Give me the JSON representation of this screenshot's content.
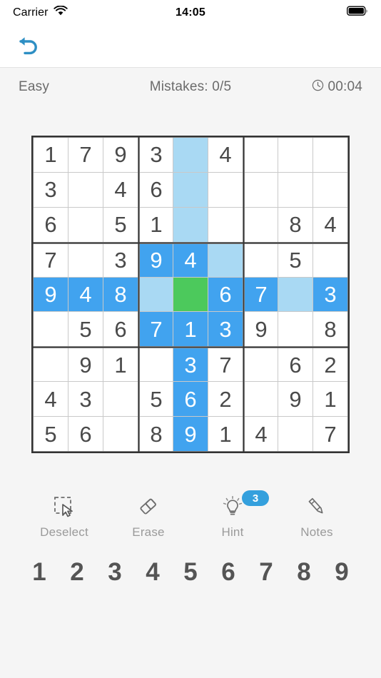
{
  "status_bar": {
    "carrier": "Carrier",
    "wifi_icon": "wifi-icon",
    "time": "14:05",
    "battery_icon": "battery-full-icon"
  },
  "nav": {
    "undo_icon": "undo-arrow-icon",
    "undo_color": "#2e8fc4"
  },
  "info": {
    "difficulty": "Easy",
    "mistakes": "Mistakes: 0/5",
    "timer_icon": "clock-icon",
    "timer": "00:04"
  },
  "board": {
    "colors": {
      "grid_line_thick": "#333333",
      "grid_line_thin": "#c9c9c9",
      "cell_bg": "#ffffff",
      "highlight_peer": "#41a3ef",
      "highlight_soft": "#a9d9f3",
      "highlight_selected": "#4cc95c",
      "digit": "#4a4a4a",
      "digit_on_highlight": "#ffffff"
    },
    "selected_cell": {
      "row": 5,
      "col": 5
    },
    "rows": [
      [
        {
          "v": "1",
          "s": "normal"
        },
        {
          "v": "7",
          "s": "normal"
        },
        {
          "v": "9",
          "s": "normal"
        },
        {
          "v": "3",
          "s": "normal"
        },
        {
          "v": "",
          "s": "soft"
        },
        {
          "v": "4",
          "s": "normal"
        },
        {
          "v": "",
          "s": "normal"
        },
        {
          "v": "",
          "s": "normal"
        },
        {
          "v": "",
          "s": "normal"
        }
      ],
      [
        {
          "v": "3",
          "s": "normal"
        },
        {
          "v": "",
          "s": "normal"
        },
        {
          "v": "4",
          "s": "normal"
        },
        {
          "v": "6",
          "s": "normal"
        },
        {
          "v": "",
          "s": "soft"
        },
        {
          "v": "",
          "s": "normal"
        },
        {
          "v": "",
          "s": "normal"
        },
        {
          "v": "",
          "s": "normal"
        },
        {
          "v": "",
          "s": "normal"
        }
      ],
      [
        {
          "v": "6",
          "s": "normal"
        },
        {
          "v": "",
          "s": "normal"
        },
        {
          "v": "5",
          "s": "normal"
        },
        {
          "v": "1",
          "s": "normal"
        },
        {
          "v": "",
          "s": "soft"
        },
        {
          "v": "",
          "s": "normal"
        },
        {
          "v": "",
          "s": "normal"
        },
        {
          "v": "8",
          "s": "normal"
        },
        {
          "v": "4",
          "s": "normal"
        }
      ],
      [
        {
          "v": "7",
          "s": "normal"
        },
        {
          "v": "",
          "s": "normal"
        },
        {
          "v": "3",
          "s": "normal"
        },
        {
          "v": "9",
          "s": "peer"
        },
        {
          "v": "4",
          "s": "peer"
        },
        {
          "v": "",
          "s": "soft"
        },
        {
          "v": "",
          "s": "normal"
        },
        {
          "v": "5",
          "s": "normal"
        },
        {
          "v": "",
          "s": "normal"
        }
      ],
      [
        {
          "v": "9",
          "s": "peer"
        },
        {
          "v": "4",
          "s": "peer"
        },
        {
          "v": "8",
          "s": "peer"
        },
        {
          "v": "",
          "s": "soft"
        },
        {
          "v": "",
          "s": "selected"
        },
        {
          "v": "6",
          "s": "peer"
        },
        {
          "v": "7",
          "s": "peer"
        },
        {
          "v": "",
          "s": "soft"
        },
        {
          "v": "3",
          "s": "peer"
        }
      ],
      [
        {
          "v": "",
          "s": "normal"
        },
        {
          "v": "5",
          "s": "normal"
        },
        {
          "v": "6",
          "s": "normal"
        },
        {
          "v": "7",
          "s": "peer"
        },
        {
          "v": "1",
          "s": "peer"
        },
        {
          "v": "3",
          "s": "peer"
        },
        {
          "v": "9",
          "s": "normal"
        },
        {
          "v": "",
          "s": "normal"
        },
        {
          "v": "8",
          "s": "normal"
        }
      ],
      [
        {
          "v": "",
          "s": "normal"
        },
        {
          "v": "9",
          "s": "normal"
        },
        {
          "v": "1",
          "s": "normal"
        },
        {
          "v": "",
          "s": "normal"
        },
        {
          "v": "3",
          "s": "peer"
        },
        {
          "v": "7",
          "s": "normal"
        },
        {
          "v": "",
          "s": "normal"
        },
        {
          "v": "6",
          "s": "normal"
        },
        {
          "v": "2",
          "s": "normal"
        }
      ],
      [
        {
          "v": "4",
          "s": "normal"
        },
        {
          "v": "3",
          "s": "normal"
        },
        {
          "v": "",
          "s": "normal"
        },
        {
          "v": "5",
          "s": "normal"
        },
        {
          "v": "6",
          "s": "peer"
        },
        {
          "v": "2",
          "s": "normal"
        },
        {
          "v": "",
          "s": "normal"
        },
        {
          "v": "9",
          "s": "normal"
        },
        {
          "v": "1",
          "s": "normal"
        }
      ],
      [
        {
          "v": "5",
          "s": "normal"
        },
        {
          "v": "6",
          "s": "normal"
        },
        {
          "v": "",
          "s": "normal"
        },
        {
          "v": "8",
          "s": "normal"
        },
        {
          "v": "9",
          "s": "peer"
        },
        {
          "v": "1",
          "s": "normal"
        },
        {
          "v": "4",
          "s": "normal"
        },
        {
          "v": "",
          "s": "normal"
        },
        {
          "v": "7",
          "s": "normal"
        }
      ]
    ]
  },
  "toolbar": [
    {
      "label": "Deselect",
      "icon": "deselect-cursor-icon",
      "badge": null
    },
    {
      "label": "Erase",
      "icon": "eraser-icon",
      "badge": null
    },
    {
      "label": "Hint",
      "icon": "lightbulb-icon",
      "badge": "3"
    },
    {
      "label": "Notes",
      "icon": "pencil-icon",
      "badge": null
    }
  ],
  "numpad": [
    "1",
    "2",
    "3",
    "4",
    "5",
    "6",
    "7",
    "8",
    "9"
  ]
}
